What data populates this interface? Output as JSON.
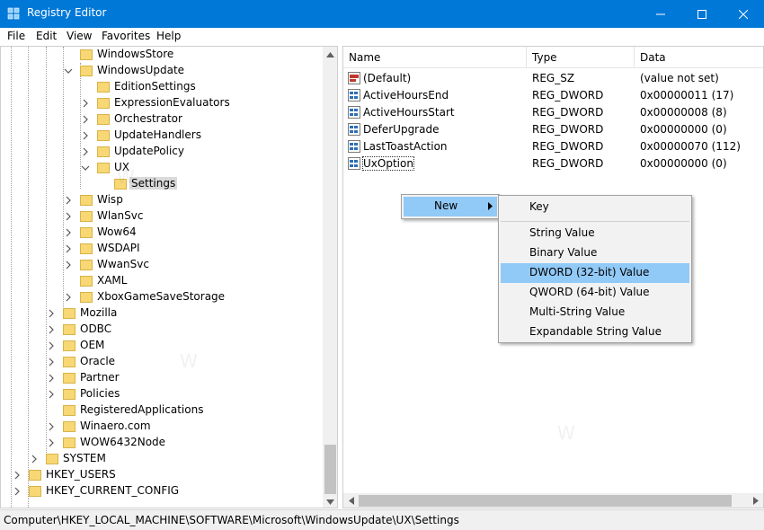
{
  "window": {
    "title": "Registry Editor"
  },
  "menu": [
    "File",
    "Edit",
    "View",
    "Favorites",
    "Help"
  ],
  "tree": [
    {
      "label": "WindowsStore",
      "indent": 4,
      "expander": "none"
    },
    {
      "label": "WindowsUpdate",
      "indent": 4,
      "expander": "open"
    },
    {
      "label": "EditionSettings",
      "indent": 5,
      "expander": "none"
    },
    {
      "label": "ExpressionEvaluators",
      "indent": 5,
      "expander": "closed"
    },
    {
      "label": "Orchestrator",
      "indent": 5,
      "expander": "closed"
    },
    {
      "label": "UpdateHandlers",
      "indent": 5,
      "expander": "closed"
    },
    {
      "label": "UpdatePolicy",
      "indent": 5,
      "expander": "closed"
    },
    {
      "label": "UX",
      "indent": 5,
      "expander": "open"
    },
    {
      "label": "Settings",
      "indent": 6,
      "expander": "none",
      "selected": true
    },
    {
      "label": "Wisp",
      "indent": 4,
      "expander": "closed"
    },
    {
      "label": "WlanSvc",
      "indent": 4,
      "expander": "closed"
    },
    {
      "label": "Wow64",
      "indent": 4,
      "expander": "closed"
    },
    {
      "label": "WSDAPI",
      "indent": 4,
      "expander": "closed"
    },
    {
      "label": "WwanSvc",
      "indent": 4,
      "expander": "closed"
    },
    {
      "label": "XAML",
      "indent": 4,
      "expander": "none"
    },
    {
      "label": "XboxGameSaveStorage",
      "indent": 4,
      "expander": "closed"
    },
    {
      "label": "Mozilla",
      "indent": 3,
      "expander": "closed"
    },
    {
      "label": "ODBC",
      "indent": 3,
      "expander": "closed"
    },
    {
      "label": "OEM",
      "indent": 3,
      "expander": "closed"
    },
    {
      "label": "Oracle",
      "indent": 3,
      "expander": "closed"
    },
    {
      "label": "Partner",
      "indent": 3,
      "expander": "closed"
    },
    {
      "label": "Policies",
      "indent": 3,
      "expander": "closed"
    },
    {
      "label": "RegisteredApplications",
      "indent": 3,
      "expander": "none"
    },
    {
      "label": "Winaero.com",
      "indent": 3,
      "expander": "closed"
    },
    {
      "label": "WOW6432Node",
      "indent": 3,
      "expander": "closed"
    },
    {
      "label": "SYSTEM",
      "indent": 2,
      "expander": "closed"
    },
    {
      "label": "HKEY_USERS",
      "indent": 1,
      "expander": "closed"
    },
    {
      "label": "HKEY_CURRENT_CONFIG",
      "indent": 1,
      "expander": "closed"
    }
  ],
  "list": {
    "headers": {
      "name": "Name",
      "type": "Type",
      "data": "Data"
    },
    "rows": [
      {
        "icon": "string-value-icon",
        "name": "(Default)",
        "type": "REG_SZ",
        "data": "(value not set)"
      },
      {
        "icon": "binary-value-icon",
        "name": "ActiveHoursEnd",
        "type": "REG_DWORD",
        "data": "0x00000011 (17)"
      },
      {
        "icon": "binary-value-icon",
        "name": "ActiveHoursStart",
        "type": "REG_DWORD",
        "data": "0x00000008 (8)"
      },
      {
        "icon": "binary-value-icon",
        "name": "DeferUpgrade",
        "type": "REG_DWORD",
        "data": "0x00000000 (0)"
      },
      {
        "icon": "binary-value-icon",
        "name": "LastToastAction",
        "type": "REG_DWORD",
        "data": "0x00000070 (112)"
      },
      {
        "icon": "binary-value-icon",
        "name": "UxOption",
        "type": "REG_DWORD",
        "data": "0x00000000 (0)",
        "selected": true
      }
    ]
  },
  "context_menu": {
    "new_label": "New"
  },
  "submenu": {
    "items": [
      "Key",
      "String Value",
      "Binary Value",
      "DWORD (32-bit) Value",
      "QWORD (64-bit) Value",
      "Multi-String Value",
      "Expandable String Value"
    ],
    "highlighted": "DWORD (32-bit) Value"
  },
  "status": "Computer\\HKEY_LOCAL_MACHINE\\SOFTWARE\\Microsoft\\WindowsUpdate\\UX\\Settings",
  "colors": {
    "titlebar": "#0078d7",
    "highlight": "#91c9f7",
    "folder": "#f8d775"
  }
}
